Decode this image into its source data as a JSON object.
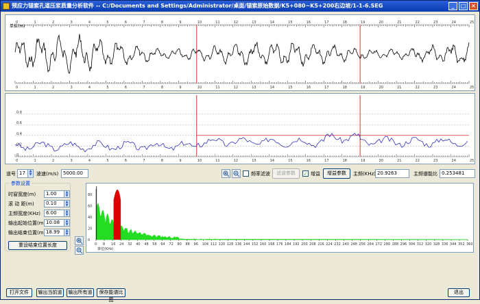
{
  "window": {
    "title": "预应力锚索孔道压浆质量分析软件 -- C:/Documents and Settings/Administrator/桌面/锚索原始数据/K5+080~K5+200右边坡/1-1-6.SEG",
    "minimize": "_",
    "maximize": "□",
    "close": "×"
  },
  "waveform": {
    "ylabel": "单位(m)",
    "ticks": [
      "0",
      "1",
      "2",
      "3",
      "4",
      "5",
      "6",
      "7",
      "8",
      "9",
      "10",
      "11",
      "12",
      "13",
      "14",
      "15",
      "16",
      "17",
      "18",
      "19",
      "20",
      "21",
      "22",
      "23",
      "24",
      "25"
    ],
    "marker1": "10",
    "marker2": "19",
    "color": "#000000",
    "marker_color": "#CC0000"
  },
  "energy_plot": {
    "ylabels": [
      "0.8",
      "0.6",
      "0.4",
      "0.2",
      "0"
    ],
    "ticks": [
      "0",
      "1",
      "2",
      "3",
      "4",
      "5",
      "6",
      "7",
      "8",
      "9",
      "10",
      "11",
      "12",
      "13",
      "14",
      "15",
      "16",
      "17",
      "18",
      "19",
      "20",
      "21",
      "22",
      "23",
      "24",
      "25"
    ],
    "threshold": 0.4,
    "line_color": "#3030C0",
    "threshold_color": "#CC0000"
  },
  "toolbar": {
    "channel_label": "道号",
    "channel_value": "17",
    "velocity_label": "波速(m/s)",
    "velocity_value": "5000.00",
    "zoom_in_icon": "zoom-in",
    "zoom_out_icon": "zoom-out",
    "freq_filter_label": "频率滤波",
    "freq_filter_checked": false,
    "filter_params_button": "滤波参数",
    "gain_label": "增益",
    "gain_checked": true,
    "gain_params_button": "增益参数",
    "main_freq_label": "主频(KHz)",
    "main_freq_value": "20.9263",
    "energy_ratio_label": "主频谱能比",
    "energy_ratio_value": "0.253481"
  },
  "params": {
    "group_title": "参数设置",
    "rows": [
      {
        "label": "时窗宽度(m)",
        "value": "1.00"
      },
      {
        "label": "滚 动 距(m)",
        "value": "0.10"
      },
      {
        "label": "主频宽度(KHz)",
        "value": "6.00"
      },
      {
        "label": "输出起始位置(m)",
        "value": "10.08"
      },
      {
        "label": "输出结束位置(m)",
        "value": "18.99"
      }
    ],
    "reset_button": "重设结束位置长度"
  },
  "spectrum": {
    "ylabels": [
      "80",
      "60",
      "40",
      "20",
      "0"
    ],
    "xticks": [
      "0",
      "8",
      "16",
      "24",
      "32",
      "40",
      "48",
      "56",
      "64",
      "72",
      "80",
      "88",
      "96",
      "104",
      "112",
      "120",
      "128",
      "136",
      "144",
      "152",
      "160",
      "168",
      "176",
      "184",
      "192",
      "200",
      "208",
      "216",
      "224",
      "232",
      "240",
      "248",
      "256",
      "264",
      "272",
      "280",
      "288",
      "296",
      "304",
      "312",
      "320",
      "328",
      "336",
      "344",
      "352",
      "360"
    ],
    "xlabel": "单位(KHz)",
    "fill_color": "#22DD22",
    "peak_color": "#DD0000"
  },
  "buttons": {
    "open_file": "打开文件",
    "export_current": "输出当前道",
    "export_all": "输出所有道",
    "save_spectrum": "保存能谱比图",
    "exit": "退出"
  }
}
